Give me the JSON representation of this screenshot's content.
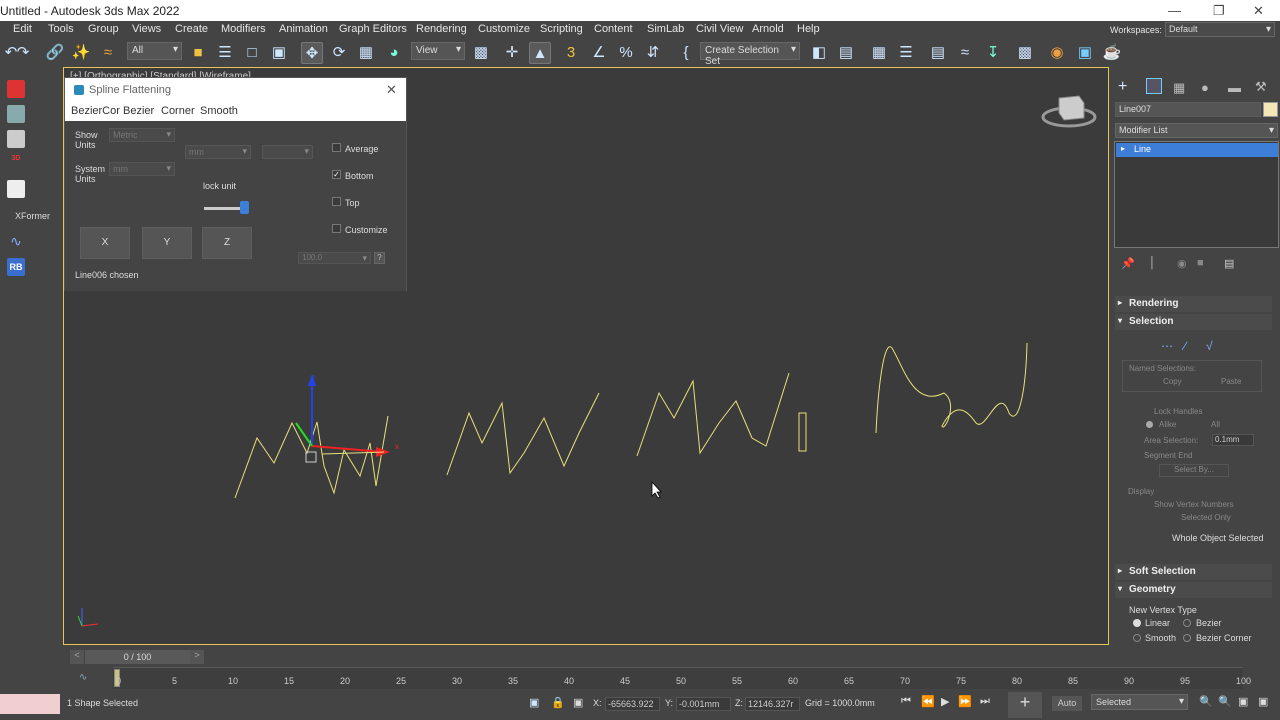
{
  "title": "Untitled - Autodesk 3ds Max 2022",
  "workspace": {
    "label": "Workspaces:",
    "value": "Default"
  },
  "menu": [
    "Edit",
    "Tools",
    "Group",
    "Views",
    "Create",
    "Modifiers",
    "Animation",
    "Graph Editors",
    "Rendering",
    "Customize",
    "Scripting",
    "Content",
    "SimLab",
    "Civil View",
    "Arnold",
    "Help"
  ],
  "toolbar": {
    "filter": "All",
    "view": "View",
    "selection_set": "Create Selection Set"
  },
  "viewport_label": "[+] [Orthographic] [Standard] [Wireframe]",
  "left_toolbar": {
    "xformer": "XFormer",
    "rb": "RB"
  },
  "dialog": {
    "title": "Spline Flattening",
    "tabs": [
      "BezierCor",
      "Bezier",
      "Corner",
      "Smooth"
    ],
    "show_units": "Show\nUnits",
    "show_units_value": "Metric",
    "mm1": "mm",
    "system_units": "System\nUnits",
    "system_units_value": "mm",
    "lock_unit": "lock unit",
    "average": "Average",
    "bottom": "Bottom",
    "top": "Top",
    "customize": "Customize",
    "x": "X",
    "y": "Y",
    "z": "Z",
    "spinner_value": "100.0",
    "help": "?",
    "status": "Line006 chosen"
  },
  "cmd": {
    "object_name": "Line007",
    "modifier_list": "Modifier List",
    "stack_item": "Line",
    "rendering": "Rendering",
    "selection": "Selection",
    "named_selections": "Named Selections:",
    "copy": "Copy",
    "paste": "Paste",
    "lock_handles": "Lock Handles",
    "alike": "Alike",
    "all": "All",
    "area_selection": "Area Selection:",
    "area_value": "0.1mm",
    "segment_end": "Segment End",
    "select_by": "Select By...",
    "display": "Display",
    "show_vertex_numbers": "Show Vertex Numbers",
    "selected_only": "Selected Only",
    "whole_object": "Whole Object Selected",
    "soft_selection": "Soft Selection",
    "geometry": "Geometry",
    "new_vertex_type": "New Vertex Type",
    "linear": "Linear",
    "bezier": "Bezier",
    "smooth": "Smooth",
    "bezier_corner": "Bezier Corner"
  },
  "timeline": {
    "frame": "0 / 100",
    "ticks": [
      "0",
      "5",
      "10",
      "15",
      "20",
      "25",
      "30",
      "35",
      "40",
      "45",
      "50",
      "55",
      "60",
      "65",
      "70",
      "75",
      "80",
      "85",
      "90",
      "95",
      "100"
    ]
  },
  "status": {
    "selected": "1 Shape Selected",
    "x_label": "X:",
    "x": "-65663.922",
    "y_label": "Y:",
    "y": "-0.001mm",
    "z_label": "Z:",
    "z": "12146.327r",
    "grid": "Grid = 1000.0mm",
    "auto": "Auto",
    "selected_dd": "Selected"
  },
  "colors": {
    "accent": "#3d7fd8",
    "select_border": "#e3c55a",
    "spline": "#e8e07a"
  }
}
